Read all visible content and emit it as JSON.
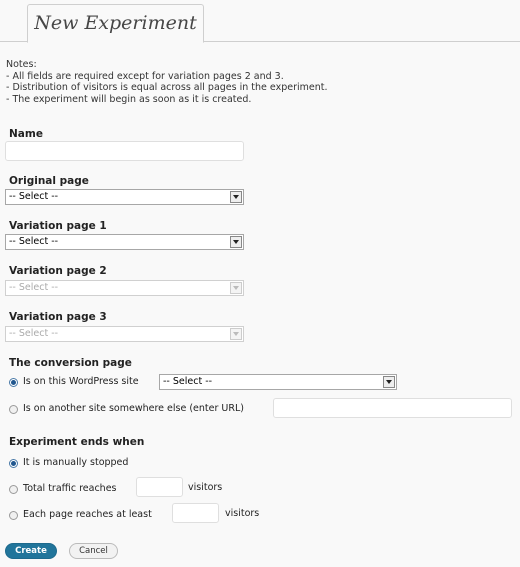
{
  "tab": {
    "title": "New Experiment"
  },
  "notes": {
    "heading": "Notes:",
    "items": [
      "- All fields are required except for variation pages 2 and 3.",
      "- Distribution of visitors is equal across all pages in the experiment.",
      "- The experiment will begin as soon as it is created."
    ]
  },
  "form": {
    "name_label": "Name",
    "name_value": "",
    "original_label": "Original page",
    "original_value": "-- Select --",
    "variation1_label": "Variation page 1",
    "variation1_value": "-- Select --",
    "variation2_label": "Variation page 2",
    "variation2_value": "-- Select --",
    "variation3_label": "Variation page 3",
    "variation3_value": "-- Select --"
  },
  "conversion": {
    "heading": "The conversion page",
    "option1_label": "Is on this WordPress site",
    "option1_select_value": "-- Select --",
    "option2_label": "Is on another site somewhere else (enter URL)",
    "url_value": ""
  },
  "ends": {
    "heading": "Experiment ends when",
    "option1_label": "It is manually stopped",
    "option2_label": "Total traffic reaches",
    "option2_suffix": "visitors",
    "option3_label": "Each page reaches at least",
    "option3_suffix": "visitors"
  },
  "buttons": {
    "create": "Create",
    "cancel": "Cancel"
  },
  "colors": {
    "primary": "#21759b",
    "background": "#f9f9f9"
  }
}
